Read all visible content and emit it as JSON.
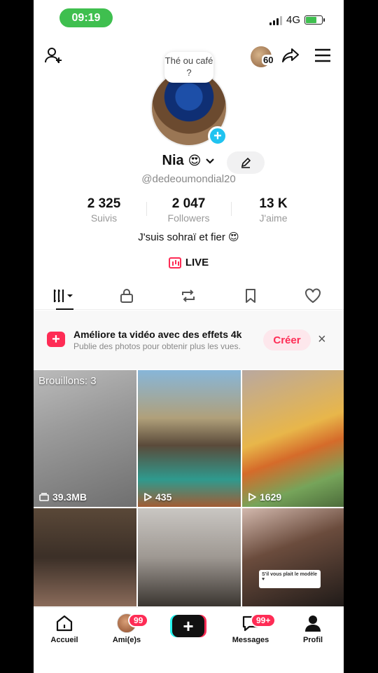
{
  "status": {
    "time": "09:19",
    "network": "4G"
  },
  "header": {
    "visitor_count": "60"
  },
  "profile": {
    "note": "Thé ou café ?",
    "name": "Nia",
    "name_emoji": "😍",
    "handle": "@dedeoumondial20",
    "bio": "J'suis sohraï et fier 😍",
    "live_label": "LIVE"
  },
  "stats": [
    {
      "value": "2 325",
      "label": "Suivis"
    },
    {
      "value": "2 047",
      "label": "Followers"
    },
    {
      "value": "13 K",
      "label": "J'aime"
    }
  ],
  "banner": {
    "title": "Améliore ta vidéo avec des effets 4k",
    "subtitle": "Publie des photos pour obtenir plus les vues.",
    "cta": "Créer",
    "close": "×"
  },
  "videos": [
    {
      "top_label": "Brouillons: 3",
      "overlay": "39.3MB"
    },
    {
      "overlay": "435"
    },
    {
      "overlay": "1629"
    },
    {
      "overlay": ""
    },
    {
      "overlay": ""
    },
    {
      "overlay": "",
      "caption": "S'il vous plait le modèle ♥"
    }
  ],
  "nav": {
    "home": "Accueil",
    "friends": "Ami(e)s",
    "friends_badge": "99",
    "messages": "Messages",
    "messages_badge": "99+",
    "profile": "Profil"
  },
  "colors": {
    "accent": "#fe2c55",
    "cyan": "#25f4ee",
    "status_green": "#3fbf4f"
  }
}
